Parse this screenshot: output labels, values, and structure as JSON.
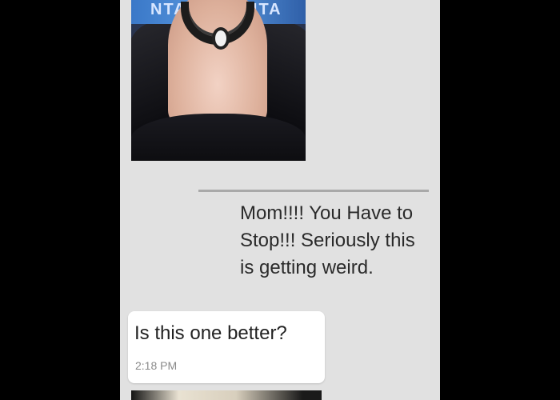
{
  "chat": {
    "messages": [
      {
        "type": "image",
        "image": {
          "sign_left": "NTA",
          "sign_right": "NTA"
        }
      },
      {
        "type": "text",
        "direction": "sent",
        "text": "Mom!!!! You Have to Stop!!! Seriously this is getting weird."
      },
      {
        "type": "text",
        "direction": "received",
        "text": "Is this one better?",
        "time": "2:18 PM"
      },
      {
        "type": "image"
      }
    ]
  },
  "colors": {
    "background": "#000000",
    "chat_background": "#e1e1e1",
    "received_bubble": "#ffffff",
    "divider": "#a9a9a9"
  }
}
